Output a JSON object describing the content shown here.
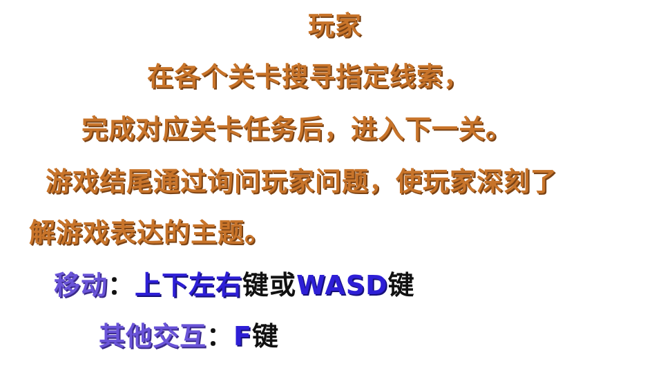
{
  "intro": {
    "line1": "玩家",
    "line2": "在各个关卡搜寻指定线索，",
    "line3": "完成对应关卡任务后，进入下一关。",
    "line4": "游戏结尾通过询问玩家问题，使玩家深刻了",
    "line5": "解游戏表达的主题。"
  },
  "controls": {
    "move": {
      "label": "移动",
      "colon": "：",
      "arrows": "上下左右",
      "key_suffix_1": "键",
      "or": "或",
      "wasd": "WASD",
      "key_suffix_2": "键"
    },
    "other": {
      "label": "其他交互",
      "colon": "：",
      "key": "F",
      "key_suffix": "键"
    }
  },
  "colors": {
    "intro_text": "#c8742a",
    "label_text": "#6a54d8",
    "key_text": "#2e1fd6",
    "plain_text": "#111111",
    "background": "#ffffff"
  }
}
